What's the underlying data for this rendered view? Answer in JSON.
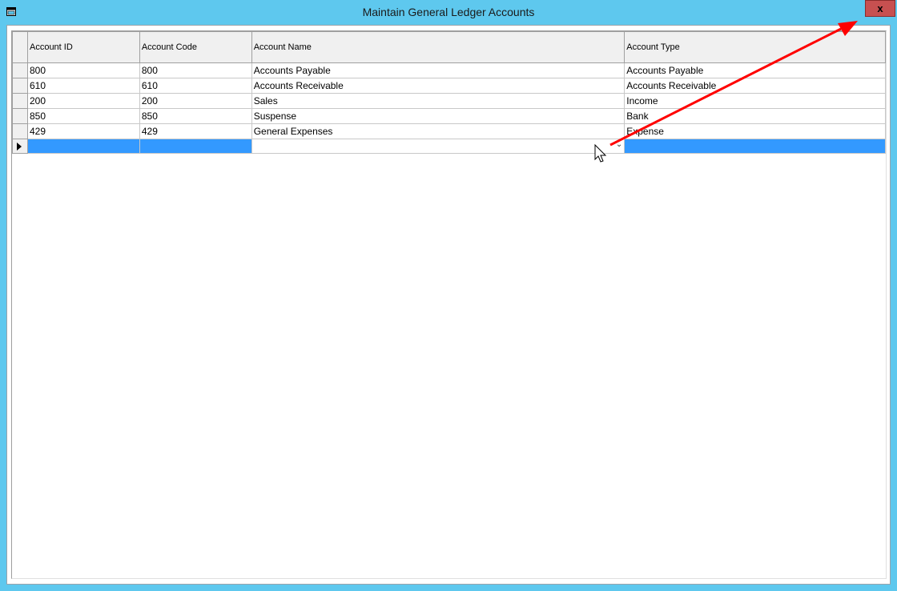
{
  "window": {
    "title": "Maintain General Ledger Accounts",
    "close_label": "x",
    "accent_color": "#5ec8ee",
    "close_color": "#c75050"
  },
  "grid": {
    "columns": [
      "Account ID",
      "Account Code",
      "Account Name",
      "Account Type"
    ],
    "rows": [
      {
        "id": "800",
        "code": "800",
        "name": "Accounts Payable",
        "type": "Accounts Payable"
      },
      {
        "id": "610",
        "code": "610",
        "name": "Accounts Receivable",
        "type": "Accounts Receivable"
      },
      {
        "id": "200",
        "code": "200",
        "name": "Sales",
        "type": "Income"
      },
      {
        "id": "850",
        "code": "850",
        "name": "Suspense",
        "type": "Bank"
      },
      {
        "id": "429",
        "code": "429",
        "name": "General Expenses",
        "type": "Expense"
      }
    ],
    "new_row": {
      "id": "",
      "code": "",
      "name": "",
      "type": ""
    },
    "selection_color": "#3399ff"
  },
  "annotation": {
    "arrow_color": "#ff0000",
    "arrow_icon": "red-arrow-icon",
    "cursor_icon": "mouse-pointer-icon"
  }
}
